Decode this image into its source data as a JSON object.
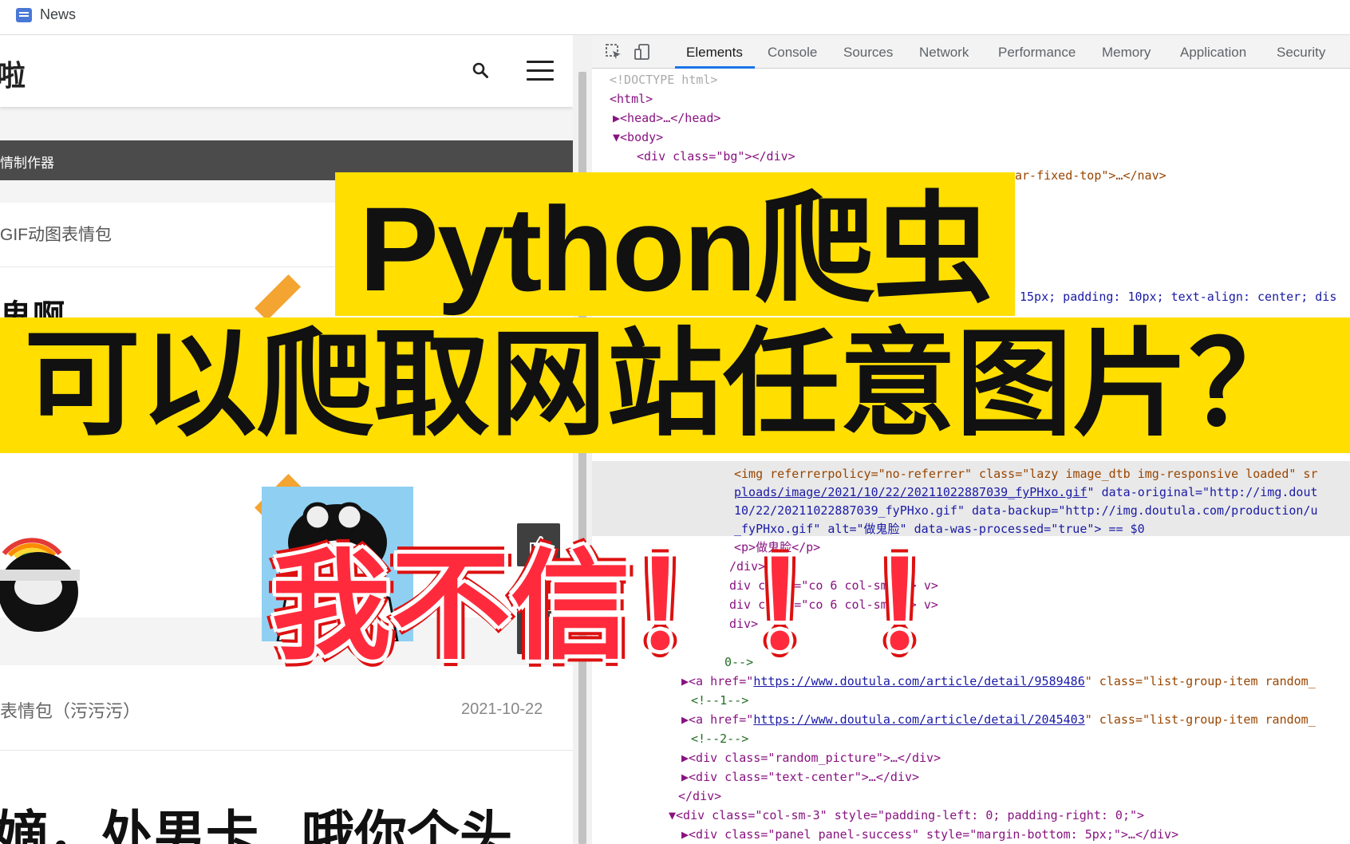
{
  "bookmarks": {
    "news_label": "News"
  },
  "webpage": {
    "site_title": "啦",
    "dark_bar_text": "情制作器",
    "section_title": "GIF动图表情包",
    "meme_caption": "鬼啊",
    "article_title": "表情包（污污污）",
    "article_date": "2021-10-22",
    "bottom_text_left": "嫡，处男卡",
    "bottom_text_right": "哦你个头"
  },
  "devtools": {
    "tabs": [
      "Elements",
      "Console",
      "Sources",
      "Network",
      "Performance",
      "Memory",
      "Application",
      "Security"
    ],
    "active_tab": "Elements",
    "lines": {
      "doctype": "<!DOCTYPE html>",
      "html_open": "<html>",
      "head": "▶<head>…</head>",
      "body_open": "▼<body>",
      "div_bg": "<div class=\"bg\"></div>",
      "nav_fixed": "ar-fixed-top\">…</nav>",
      "style_frag": "15px; padding: 10px; text-align: center; dis",
      "img_attrs_1": "<img referrerpolicy=\"no-referrer\" class=\"lazy image_dtb img-responsive loaded\" sr",
      "img_attrs_2a": "ploads/image/2021/10/22/20211022887039_fyPHxo.gif",
      "img_attrs_2b": "\" data-original=\"http://img.dout",
      "img_attrs_3": "10/22/20211022887039_fyPHxo.gif\" data-backup=\"http://img.doutula.com/production/u",
      "img_attrs_4": "_fyPHxo.gif\" alt=\"做鬼脸\" data-was-processed=\"true\"> == $0",
      "p_text": "<p>做鬼脸</p>",
      "div_close": "/div>",
      "col_1": "div class=\"co        6 col-sm-3\">      v>",
      "col_2": "div class=\"co        6 col-sm-3\">      v>",
      "div_close_2": "div>",
      "comment_0": "0-->",
      "link_1_pre": "▶<a href=\"",
      "link_1_url": "https://www.doutula.com/article/detail/9589486",
      "link_1_post": "\" class=\"list-group-item random_",
      "comment_1": "<!--1-->",
      "link_2_pre": "▶<a href=\"",
      "link_2_url": "https://www.doutula.com/article/detail/2045403",
      "link_2_post": "\" class=\"list-group-item random_",
      "comment_2": "<!--2-->",
      "random_picture": "▶<div class=\"random_picture\">…</div>",
      "text_center": "▶<div class=\"text-center\">…</div>",
      "div_close_3": "</div>",
      "col_sm3": "▼<div class=\"col-sm-3\" style=\"padding-left: 0; padding-right: 0;\">",
      "panel": "▶<div class=\"panel panel-success\" style=\"margin-bottom: 5px;\">…</div>"
    }
  },
  "overlay": {
    "line1": "Python爬虫",
    "line2": "可以爬取网站任意图片？",
    "line3": "我不信！！！",
    "band_color": "#ffde00",
    "line3_color": "#ff2b3d"
  },
  "icons": [
    "news-icon",
    "search-icon",
    "menu-icon",
    "like-icon",
    "trash-icon",
    "qrcode-icon",
    "inspect-icon",
    "device-toolbar-icon"
  ]
}
